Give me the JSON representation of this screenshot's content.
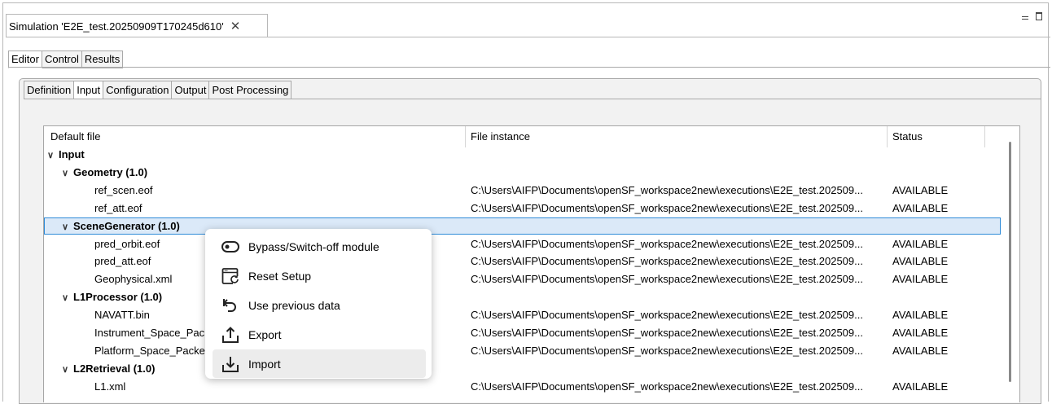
{
  "window": {
    "title_tab": "Simulation 'E2E_test.20250909T170245d610'",
    "close_symbol": "✕"
  },
  "outer_tabs": [
    "Editor",
    "Control",
    "Results"
  ],
  "inner_tabs": [
    "Definition",
    "Input",
    "Configuration",
    "Output",
    "Post Processing"
  ],
  "table": {
    "headers": [
      "Default file",
      "File instance",
      "Status"
    ],
    "rows": [
      {
        "level": 0,
        "expander": true,
        "name": "Input",
        "bold": true,
        "instance": "",
        "status": ""
      },
      {
        "level": 1,
        "expander": true,
        "name": "Geometry (1.0)",
        "bold": true,
        "instance": "",
        "status": ""
      },
      {
        "level": 2,
        "expander": false,
        "name": "ref_scen.eof",
        "bold": false,
        "instance": "C:\\Users\\AIFP\\Documents\\openSF_workspace2new\\executions\\E2E_test.202509...",
        "status": "AVAILABLE"
      },
      {
        "level": 2,
        "expander": false,
        "name": "ref_att.eof",
        "bold": false,
        "instance": "C:\\Users\\AIFP\\Documents\\openSF_workspace2new\\executions\\E2E_test.202509...",
        "status": "AVAILABLE"
      },
      {
        "level": 1,
        "expander": true,
        "name": "SceneGenerator (1.0)",
        "bold": true,
        "instance": "",
        "status": "",
        "selected": true
      },
      {
        "level": 2,
        "expander": false,
        "name": "pred_orbit.eof",
        "bold": false,
        "instance": "C:\\Users\\AIFP\\Documents\\openSF_workspace2new\\executions\\E2E_test.202509...",
        "status": "AVAILABLE"
      },
      {
        "level": 2,
        "expander": false,
        "name": "pred_att.eof",
        "bold": false,
        "instance": "C:\\Users\\AIFP\\Documents\\openSF_workspace2new\\executions\\E2E_test.202509...",
        "status": "AVAILABLE"
      },
      {
        "level": 2,
        "expander": false,
        "name": "Geophysical.xml",
        "bold": false,
        "instance": "C:\\Users\\AIFP\\Documents\\openSF_workspace2new\\executions\\E2E_test.202509...",
        "status": "AVAILABLE"
      },
      {
        "level": 1,
        "expander": true,
        "name": "L1Processor (1.0)",
        "bold": true,
        "instance": "",
        "status": ""
      },
      {
        "level": 2,
        "expander": false,
        "name": "NAVATT.bin",
        "bold": false,
        "instance": "C:\\Users\\AIFP\\Documents\\openSF_workspace2new\\executions\\E2E_test.202509...",
        "status": "AVAILABLE"
      },
      {
        "level": 2,
        "expander": false,
        "name": "Instrument_Space_Pack",
        "bold": false,
        "instance": "C:\\Users\\AIFP\\Documents\\openSF_workspace2new\\executions\\E2E_test.202509...",
        "status": "AVAILABLE"
      },
      {
        "level": 2,
        "expander": false,
        "name": "Platform_Space_Packet",
        "bold": false,
        "instance": "C:\\Users\\AIFP\\Documents\\openSF_workspace2new\\executions\\E2E_test.202509...",
        "status": "AVAILABLE"
      },
      {
        "level": 1,
        "expander": true,
        "name": "L2Retrieval (1.0)",
        "bold": true,
        "instance": "",
        "status": ""
      },
      {
        "level": 2,
        "expander": false,
        "name": "L1.xml",
        "bold": false,
        "instance": "C:\\Users\\AIFP\\Documents\\openSF_workspace2new\\executions\\E2E_test.202509...",
        "status": "AVAILABLE"
      }
    ]
  },
  "context_menu": {
    "items": [
      {
        "label": "Bypass/Switch-off module",
        "icon": "toggle-icon"
      },
      {
        "label": "Reset Setup",
        "icon": "reset-window-icon"
      },
      {
        "label": "Use previous data",
        "icon": "undo-arrow-icon"
      },
      {
        "label": "Export",
        "icon": "export-icon"
      },
      {
        "label": "Import",
        "icon": "import-icon",
        "hovered": true
      }
    ]
  }
}
